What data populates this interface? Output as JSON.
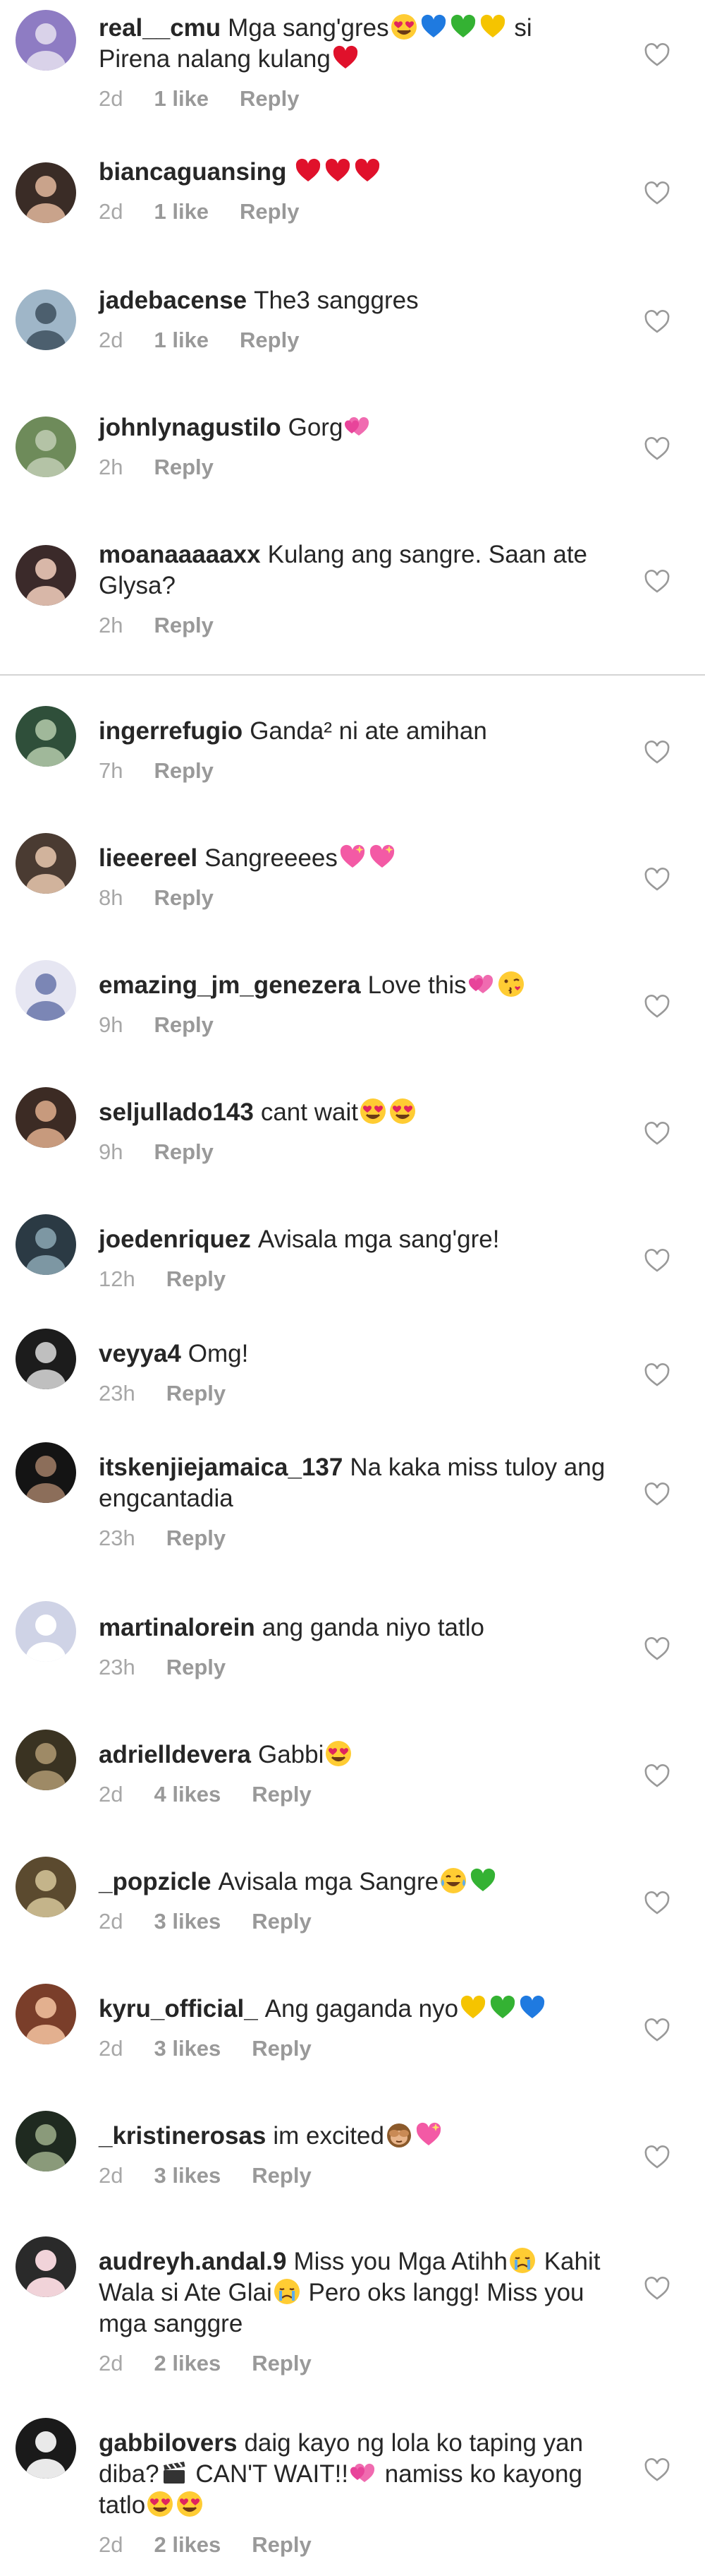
{
  "comments": [
    {
      "username": "real__cmu",
      "text": "Mga sang'gres",
      "text_after": "si Pirena nalang kulang",
      "emojis": [
        "heart-eyes",
        "blue-heart",
        "green-heart",
        "yellow-heart"
      ],
      "emojis_after": [
        "red-heart"
      ],
      "time": "2d",
      "likes": "1 like",
      "reply": "Reply"
    },
    {
      "username": "biancaguansing",
      "text": "",
      "emojis": [
        "red-heart",
        "red-heart",
        "red-heart"
      ],
      "time": "2d",
      "likes": "1 like",
      "reply": "Reply"
    },
    {
      "username": "jadebacense",
      "text": "The3 sanggres",
      "emojis": [],
      "time": "2d",
      "likes": "1 like",
      "reply": "Reply"
    },
    {
      "username": "johnlynagustilo",
      "text": "Gorg",
      "emojis": [
        "heart-emoji"
      ],
      "time": "2h",
      "likes": "",
      "reply": "Reply"
    },
    {
      "username": "moanaaaaaxx",
      "text": "Kulang ang sangre. Saan ate Glysa?",
      "emojis": [],
      "time": "2h",
      "likes": "",
      "reply": "Reply"
    },
    {
      "username": "ingerrefugio",
      "text": "Ganda² ni ate amihan",
      "emojis": [],
      "time": "7h",
      "likes": "",
      "reply": "Reply"
    },
    {
      "username": "lieeereel",
      "text": "Sangreeees",
      "emojis": [
        "sparkling-heart",
        "sparkling-heart"
      ],
      "time": "8h",
      "likes": "",
      "reply": "Reply"
    },
    {
      "username": "emazing_jm_genezera",
      "text": "Love this",
      "emojis": [
        "heart-emoji",
        "kiss-face"
      ],
      "time": "9h",
      "likes": "",
      "reply": "Reply"
    },
    {
      "username": "seljullado143",
      "text": "cant wait",
      "emojis": [
        "heart-eyes",
        "heart-eyes"
      ],
      "time": "9h",
      "likes": "",
      "reply": "Reply"
    },
    {
      "username": "joedenriquez",
      "text": "Avisala mga sang'gre!",
      "emojis": [],
      "time": "12h",
      "likes": "",
      "reply": "Reply"
    },
    {
      "username": "veyya4",
      "text": "Omg!",
      "emojis": [],
      "time": "23h",
      "likes": "",
      "reply": "Reply"
    },
    {
      "username": "itskenjiejamaica_137",
      "text": "Na kaka  miss tuloy ang engcantadia",
      "emojis": [],
      "time": "23h",
      "likes": "",
      "reply": "Reply"
    },
    {
      "username": "martinalorein",
      "text": "ang ganda niyo tatlo",
      "emojis": [],
      "time": "23h",
      "likes": "",
      "reply": "Reply"
    },
    {
      "username": "adrielldevera",
      "text": "Gabbi",
      "emojis": [
        "heart-eyes"
      ],
      "time": "2d",
      "likes": "4 likes",
      "reply": "Reply"
    },
    {
      "username": "_popzicle",
      "text": "Avisala mga Sangre",
      "emojis": [
        "tears-of-joy",
        "green-heart"
      ],
      "time": "2d",
      "likes": "3 likes",
      "reply": "Reply"
    },
    {
      "username": "kyru_official_",
      "text": "Ang gaganda nyo",
      "emojis": [
        "yellow-heart",
        "green-heart",
        "blue-heart"
      ],
      "time": "2d",
      "likes": "3 likes",
      "reply": "Reply"
    },
    {
      "username": "_kristinerosas",
      "text": "im excited",
      "emojis": [
        "see-no-evil",
        "sparkling-heart"
      ],
      "time": "2d",
      "likes": "3 likes",
      "reply": "Reply"
    },
    {
      "username": "audreyh.andal.9",
      "text": "Miss you Mga Atihh",
      "text_after": "Kahit Wala si Ate Glai",
      "text_after2": "Pero oks langg! Miss you mga sanggre",
      "emojis": [
        "crying-face"
      ],
      "emojis_after": [
        "crying-face"
      ],
      "time": "2d",
      "likes": "2 likes",
      "reply": "Reply"
    },
    {
      "username": "gabbilovers",
      "text": "daig kayo ng lola ko taping yan diba?",
      "text_after": "CAN'T WAIT!!",
      "text_after2": "namiss ko kayong tatlo",
      "emojis": [
        "clapper-board"
      ],
      "emojis_after": [
        "heart-emoji"
      ],
      "emojis_after2": [
        "heart-eyes",
        "heart-eyes"
      ],
      "time": "2d",
      "likes": "2 likes",
      "reply": "Reply"
    }
  ],
  "colors": {
    "username": "#262626",
    "meta": "#999999",
    "divider": "#d4d4d4"
  },
  "icons": {
    "like": "heart-outline-icon"
  }
}
